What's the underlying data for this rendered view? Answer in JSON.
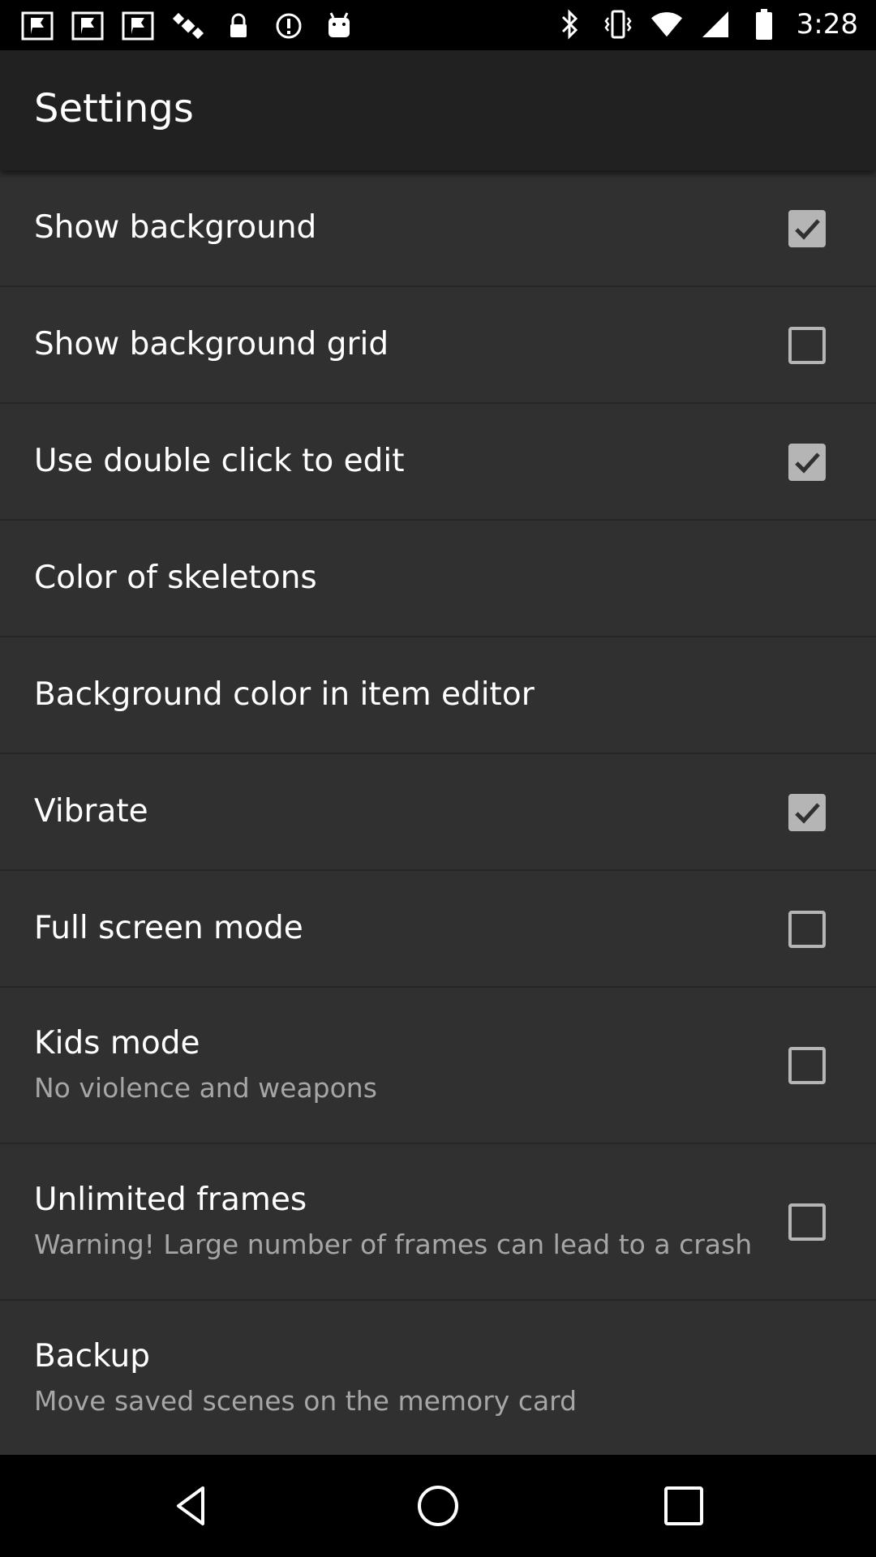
{
  "status_bar": {
    "time": "3:28",
    "left_icons": [
      "flag-icon",
      "flag-icon",
      "flag-icon",
      "satellite-icon",
      "lock-icon",
      "alert-icon",
      "android-icon"
    ],
    "right_icons": [
      "bluetooth-icon",
      "vibrate-icon",
      "wifi-icon",
      "signal-icon",
      "battery-icon"
    ]
  },
  "app_bar": {
    "title": "Settings"
  },
  "settings": [
    {
      "title": "Show background",
      "subtitle": "",
      "checkbox": true,
      "checked": true
    },
    {
      "title": "Show background grid",
      "subtitle": "",
      "checkbox": true,
      "checked": false
    },
    {
      "title": "Use double click to edit",
      "subtitle": "",
      "checkbox": true,
      "checked": true
    },
    {
      "title": "Color of skeletons",
      "subtitle": "",
      "checkbox": false,
      "checked": false
    },
    {
      "title": "Background color in item editor",
      "subtitle": "",
      "checkbox": false,
      "checked": false
    },
    {
      "title": "Vibrate",
      "subtitle": "",
      "checkbox": true,
      "checked": true
    },
    {
      "title": "Full screen mode",
      "subtitle": "",
      "checkbox": true,
      "checked": false
    },
    {
      "title": "Kids mode",
      "subtitle": "No violence and weapons",
      "checkbox": true,
      "checked": false
    },
    {
      "title": "Unlimited frames",
      "subtitle": "Warning! Large number of frames can lead to a crash",
      "checkbox": true,
      "checked": false
    },
    {
      "title": "Backup",
      "subtitle": "Move saved scenes on the memory card",
      "checkbox": false,
      "checked": false
    }
  ],
  "nav_bar": {
    "icons": [
      "back-icon",
      "home-icon",
      "recents-icon"
    ]
  },
  "colors": {
    "app_bar": "#212121",
    "list_background": "#303030",
    "checkbox": "#b5b5b5",
    "subtitle": "#a6a6a6"
  }
}
